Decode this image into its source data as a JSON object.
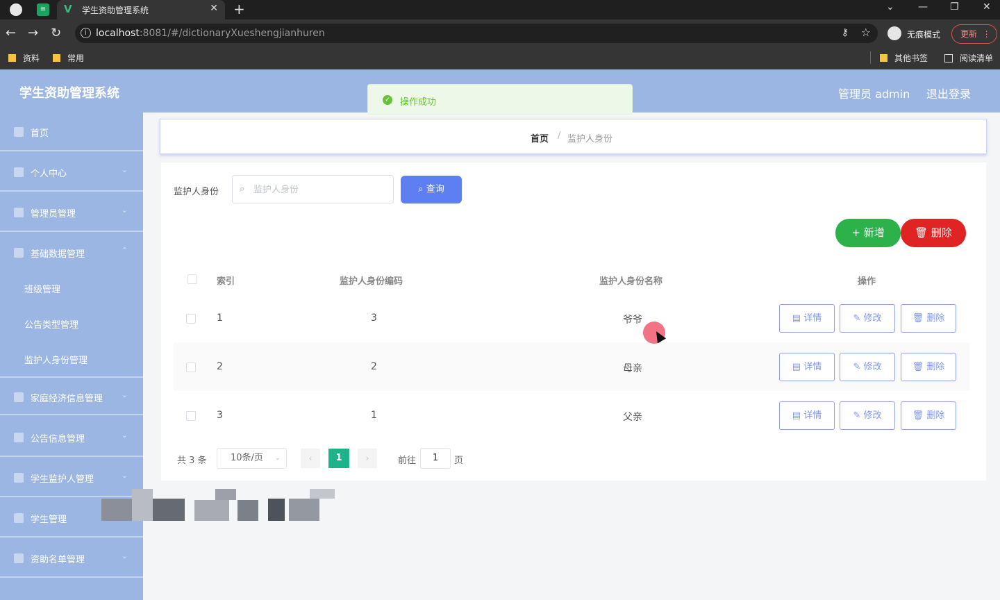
{
  "browser": {
    "tab_title": "学生资助管理系统",
    "url_host": "localhost",
    "url_path": ":8081/#/dictionaryXueshengjianhuren",
    "incognito_label": "无痕模式",
    "update_label": "更新",
    "bookmarks_left": [
      "资料",
      "常用"
    ],
    "bookmarks_right": [
      "其他书签",
      "阅读清单"
    ]
  },
  "app": {
    "title": "学生资助管理系统",
    "admin_label": "管理员 admin",
    "logout_label": "退出登录"
  },
  "toast": {
    "message": "操作成功",
    "color": "#67c23a"
  },
  "sidebar": {
    "items": [
      {
        "label": "首页",
        "icon": "home-icon"
      },
      {
        "label": "个人中心",
        "icon": "user-icon"
      },
      {
        "label": "管理员管理",
        "icon": "admin-icon"
      },
      {
        "label": "基础数据管理",
        "icon": "flag-icon"
      }
    ],
    "sub_items": [
      "班级管理",
      "公告类型管理",
      "监护人身份管理"
    ],
    "items_after": [
      {
        "label": "家庭经济信息管理",
        "icon": "user-icon"
      },
      {
        "label": "公告信息管理",
        "icon": "notice-icon"
      },
      {
        "label": "学生监护人管理",
        "icon": "guardian-icon"
      },
      {
        "label": "学生管理",
        "icon": "student-icon"
      },
      {
        "label": "资助名单管理",
        "icon": "list-icon"
      }
    ]
  },
  "breadcrumb": {
    "home": "首页",
    "separator": "/",
    "current": "监护人身份"
  },
  "search": {
    "label": "监护人身份",
    "placeholder": "监护人身份",
    "value": "",
    "button": "查询"
  },
  "actions": {
    "add": "新增",
    "delete": "删除"
  },
  "table": {
    "headers": {
      "index": "索引",
      "code": "监护人身份编码",
      "name": "监护人身份名称",
      "ops": "操作"
    },
    "rows": [
      {
        "index": "1",
        "code": "3",
        "name": "爷爷"
      },
      {
        "index": "2",
        "code": "2",
        "name": "母亲"
      },
      {
        "index": "3",
        "code": "1",
        "name": "父亲"
      }
    ],
    "row_buttons": {
      "detail": "详情",
      "edit": "修改",
      "delete": "删除"
    }
  },
  "pagination": {
    "total": "共 3 条",
    "page_size": "10条/页",
    "current_page": "1",
    "goto_label": "前往",
    "goto_value": "1",
    "unit": "页"
  },
  "colors": {
    "header_bg": "#9bb6e2",
    "primary": "#5e7ff2",
    "success": "#2db14a",
    "danger": "#e02424",
    "page_active": "#1fb38a"
  }
}
